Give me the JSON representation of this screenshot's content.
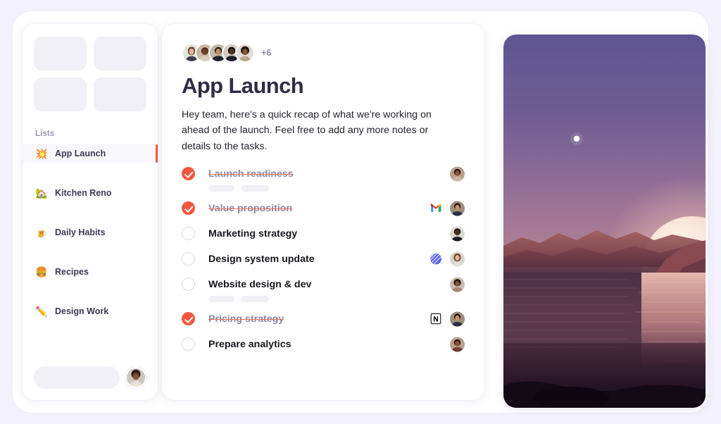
{
  "sidebar": {
    "grid_placeholder_count": 4,
    "lists_label": "Lists",
    "items": [
      {
        "label": "App Launch",
        "emoji": "💥",
        "icon_name": "collision-emoji",
        "active": true
      },
      {
        "label": "Kitchen Reno",
        "emoji": "🏡",
        "icon_name": "house-emoji",
        "active": false
      },
      {
        "label": "Daily Habits",
        "emoji": "🍺",
        "icon_name": "beverage-emoji",
        "active": false
      },
      {
        "label": "Recipes",
        "emoji": "🍔",
        "icon_name": "hamburger-emoji",
        "active": false
      },
      {
        "label": "Design Work",
        "emoji": "✏️",
        "icon_name": "pencil-emoji",
        "active": false
      }
    ],
    "search_placeholder": "",
    "user_avatar_name": "user-avatar"
  },
  "main": {
    "collaborators": {
      "count_shown": 5,
      "overflow_label": "+6"
    },
    "title": "App Launch",
    "intro": "Hey team, here's a quick recap of what we're working on ahead of the launch. Feel free to add any more notes or details to the tasks.",
    "tasks": [
      {
        "text": "Launch readiness",
        "done": true,
        "app_icon": null,
        "meta_bars": 2,
        "avatar": "avatar-1"
      },
      {
        "text": "Value proposition",
        "done": true,
        "app_icon": "gmail",
        "meta_bars": 0,
        "avatar": "avatar-2"
      },
      {
        "text": "Marketing strategy",
        "done": false,
        "app_icon": null,
        "meta_bars": 0,
        "avatar": "avatar-3"
      },
      {
        "text": "Design system update",
        "done": false,
        "app_icon": "linear",
        "meta_bars": 0,
        "avatar": "avatar-4"
      },
      {
        "text": "Website design & dev",
        "done": false,
        "app_icon": null,
        "meta_bars": 2,
        "avatar": "avatar-5"
      },
      {
        "text": "Pricing strategy",
        "done": true,
        "app_icon": "notion",
        "meta_bars": 0,
        "avatar": "avatar-6"
      },
      {
        "text": "Prepare analytics",
        "done": false,
        "app_icon": null,
        "meta_bars": 0,
        "avatar": "avatar-7"
      }
    ]
  },
  "photo": {
    "name": "moonrise-over-water-photo",
    "description": "Purple to pink gradient sky with a small star, a large rising moon, red rock mountains and calm water with moon reflection"
  },
  "colors": {
    "page_background": "#f3f1fb",
    "accent": "#f4563f",
    "card_background": "#ffffff",
    "placeholder": "#f1f0f7",
    "text_primary": "#17161d",
    "text_muted": "#8f8ba6"
  }
}
